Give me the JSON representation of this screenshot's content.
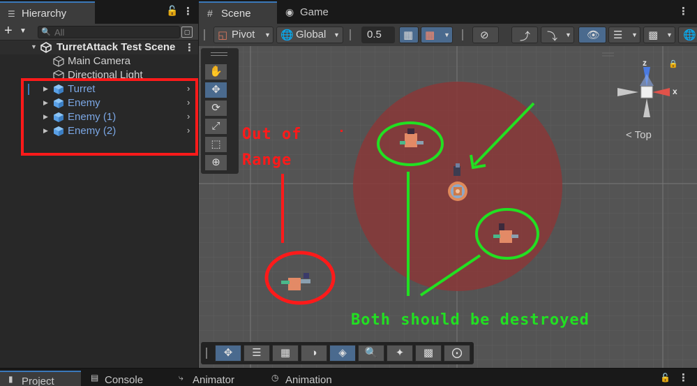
{
  "hierarchy": {
    "tab_label": "Hierarchy",
    "search_placeholder": "All",
    "scene_name": "TurretAttack Test Scenе",
    "items": [
      {
        "label": "Main Camera",
        "color": "#d2d2d2"
      },
      {
        "label": "Directional Light",
        "color": "#d2d2d2"
      },
      {
        "label": "Turret",
        "color": "#7ba7e5"
      },
      {
        "label": "Enemy",
        "color": "#7ba7e5"
      },
      {
        "label": "Enemy (1)",
        "color": "#7ba7e5"
      },
      {
        "label": "Enemy (2)",
        "color": "#7ba7e5"
      }
    ]
  },
  "scene": {
    "tabs": [
      {
        "label": "Scene",
        "icon": "grid-icon"
      },
      {
        "label": "Game",
        "icon": "gamepad-icon"
      }
    ],
    "toolbar": {
      "pivot_label": "Pivot",
      "global_label": "Global",
      "snap_value": "0.5"
    },
    "gizmo": {
      "x_label": "x",
      "z_label": "z",
      "view_label": "Top"
    }
  },
  "annotations": {
    "out_of_range_line1": "Out of",
    "out_of_range_line2": "Range",
    "both_destroyed": "Both should be destroyed",
    "red_color": "#ff1a1a",
    "green_color": "#22e022"
  },
  "bottom_tabs": [
    {
      "label": "Project",
      "icon": "folder-icon"
    },
    {
      "label": "Console",
      "icon": "console-icon"
    },
    {
      "label": "Animator",
      "icon": "animator-icon"
    },
    {
      "label": "Animation",
      "icon": "animation-icon"
    }
  ]
}
